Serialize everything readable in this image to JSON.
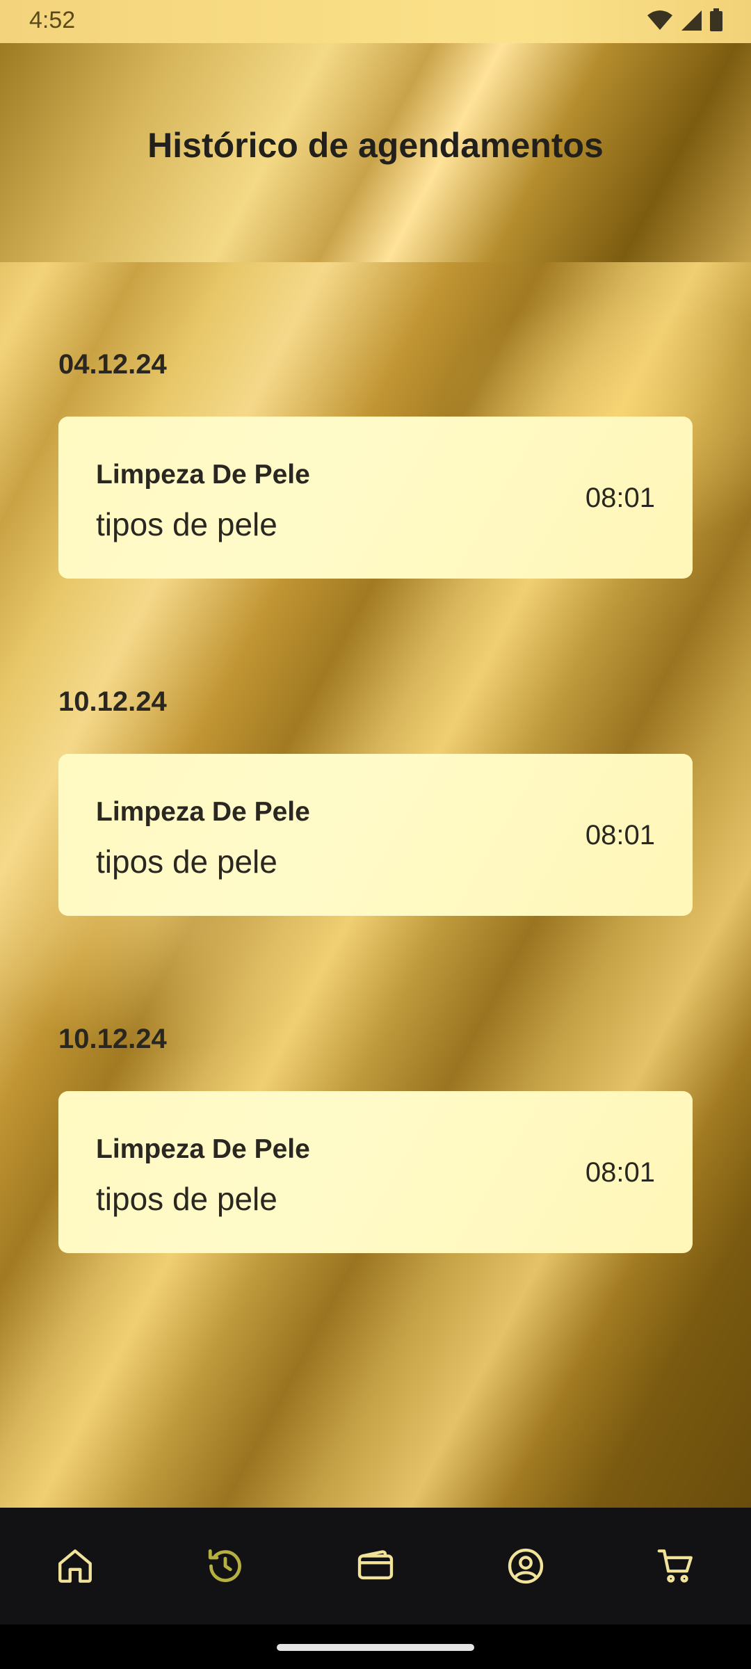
{
  "status_bar": {
    "time": "4:52"
  },
  "header": {
    "title": "Histórico de agendamentos"
  },
  "appointments": [
    {
      "date": "04.12.24",
      "title": "Limpeza De Pele",
      "subtitle": "tipos de pele",
      "time": "08:01"
    },
    {
      "date": "10.12.24",
      "title": "Limpeza De Pele",
      "subtitle": "tipos de pele",
      "time": "08:01"
    },
    {
      "date": "10.12.24",
      "title": "Limpeza De Pele",
      "subtitle": "tipos de pele",
      "time": "08:01"
    }
  ],
  "bottom_nav": {
    "items": [
      {
        "icon": "home-icon",
        "active": false
      },
      {
        "icon": "history-icon",
        "active": true
      },
      {
        "icon": "wallet-icon",
        "active": false
      },
      {
        "icon": "profile-icon",
        "active": false
      },
      {
        "icon": "cart-icon",
        "active": false
      }
    ],
    "active_color": "#b5b040",
    "inactive_color": "#f2e39a"
  }
}
